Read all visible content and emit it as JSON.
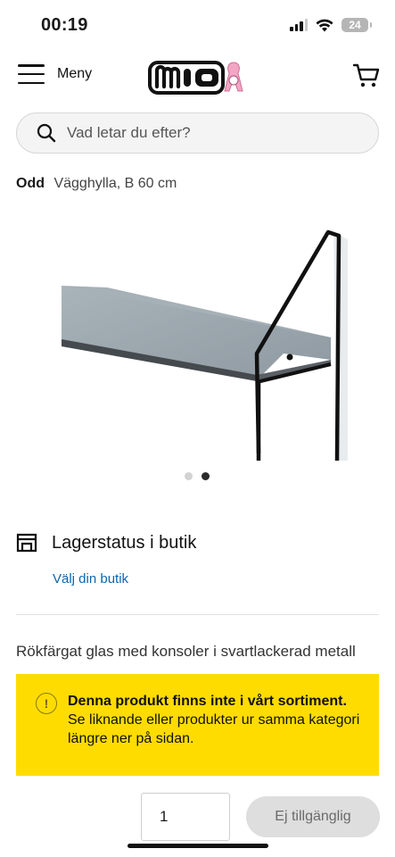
{
  "status_bar": {
    "time": "00:19",
    "battery": "24"
  },
  "header": {
    "menu_label": "Meny",
    "logo_text": "MIO"
  },
  "search": {
    "placeholder": "Vad letar du efter?"
  },
  "product": {
    "brand": "Odd",
    "name": "Vägghylla, B 60 cm",
    "image_count": 2,
    "active_image": 2
  },
  "stock": {
    "title": "Lagerstatus i butik",
    "choose_store": "Välj din butik"
  },
  "description": "Rökfärgat glas med konsoler i svartlackerad metall",
  "notice": {
    "icon": "!",
    "title": "Denna produkt finns inte i vårt sortiment.",
    "line1": "Se liknande eller produkter ur samma kategori",
    "line2": "längre ner på sidan."
  },
  "purchase": {
    "quantity": "1",
    "button_label": "Ej tillgänglig"
  },
  "colors": {
    "notice_bg": "#ffdc00",
    "link": "#0a66b0",
    "button_disabled": "#dedede"
  }
}
